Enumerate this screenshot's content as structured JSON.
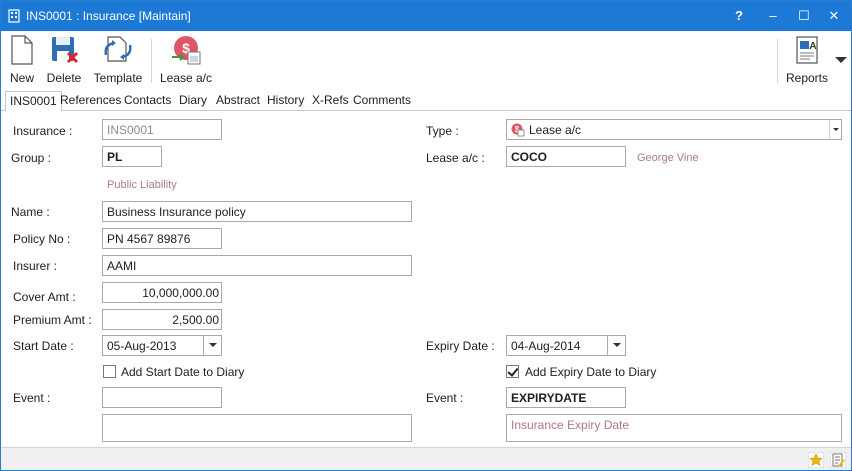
{
  "window": {
    "title": "INS0001 : Insurance [Maintain]",
    "controls": [
      "?",
      "–",
      "☐",
      "✕"
    ]
  },
  "toolbar": {
    "new_label": "New",
    "delete_label": "Delete",
    "template_label": "Template",
    "lease_label": "Lease a/c",
    "reports_label": "Reports"
  },
  "tabs": [
    "INS0001",
    "References",
    "Contacts",
    "Diary",
    "Abstract",
    "History",
    "X-Refs",
    "Comments"
  ],
  "form": {
    "insurance_label": "Insurance :",
    "insurance_value": "INS0001",
    "group_label": "Group :",
    "group_value": "PL",
    "group_desc": "Public Liability",
    "name_label": "Name :",
    "name_value": "Business Insurance policy",
    "policy_label": "Policy No :",
    "policy_value": "PN 4567 89876",
    "insurer_label": "Insurer :",
    "insurer_value": "AAMI",
    "cover_label": "Cover Amt :",
    "cover_value": "10,000,000.00",
    "premium_label": "Premium Amt :",
    "premium_value": "2,500.00",
    "start_label": "Start Date :",
    "start_value": "05-Aug-2013",
    "add_start_label": "Add Start Date to Diary",
    "add_start_checked": false,
    "event_label": "Event :",
    "event_value": "",
    "event_desc": "",
    "type_label": "Type :",
    "type_value": "Lease a/c",
    "lease_label": "Lease a/c :",
    "lease_value": "COCO",
    "lease_desc": "George Vine",
    "expiry_label": "Expiry Date :",
    "expiry_value": "04-Aug-2014",
    "add_expiry_label": "Add Expiry Date to Diary",
    "add_expiry_checked": true,
    "event2_label": "Event :",
    "event2_value": "EXPIRYDATE",
    "event2_desc": "Insurance Expiry Date"
  },
  "colors": {
    "titlebar": "#1c79d6",
    "hint": "#b07a86"
  }
}
